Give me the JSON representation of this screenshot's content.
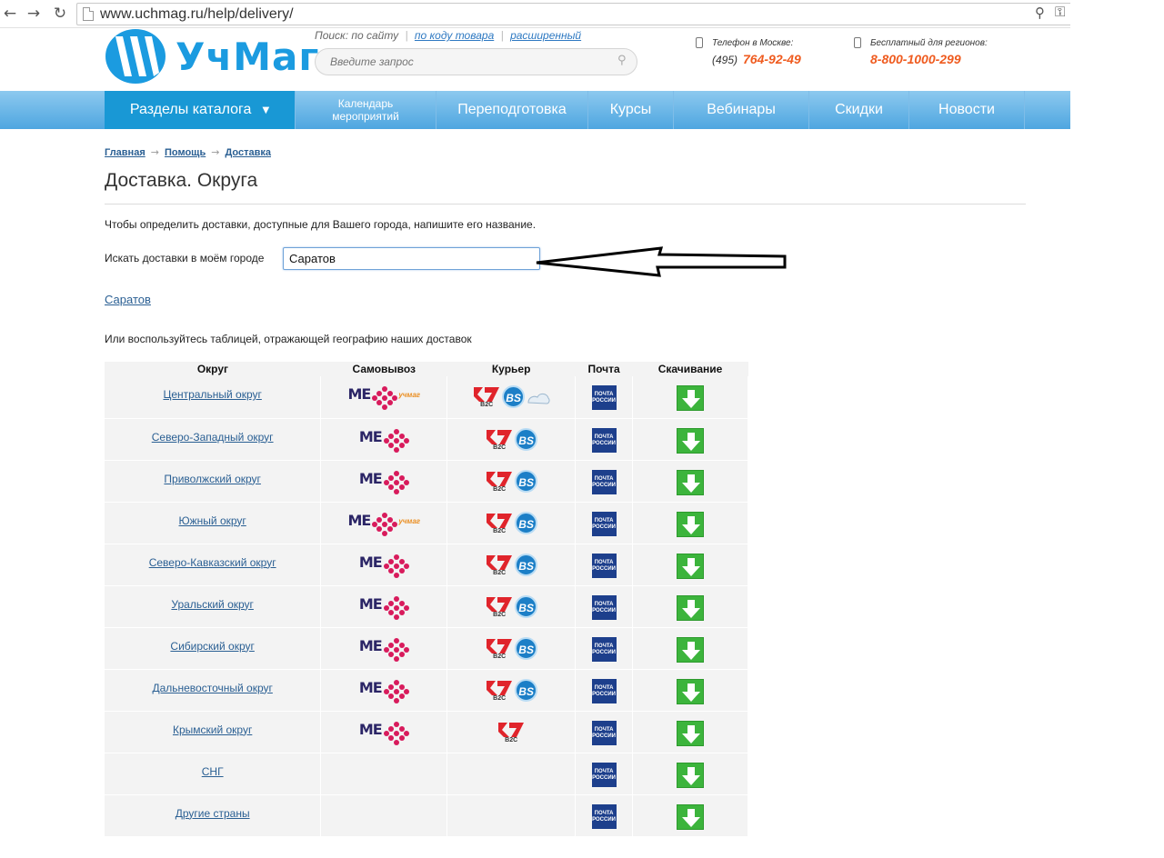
{
  "browser": {
    "back_icon": "←",
    "forward_icon": "→",
    "reload_icon": "↻",
    "url": "www.uchmag.ru/help/delivery/",
    "zoom_icon": "⚲",
    "key_icon": "⚿"
  },
  "header": {
    "logo_text": "УчМаг",
    "search_label": "Поиск:",
    "search_link_site": "по сайту",
    "search_link_code": "по коду товара",
    "search_link_ext": "расширенный",
    "search_placeholder": "Введите запрос",
    "moscow_label": "Телефон в Москве:",
    "moscow_code": "(495)",
    "moscow_phone": "764-92-49",
    "regions_label": "Бесплатный для регионов:",
    "regions_phone": "8-800-1000-299"
  },
  "nav": {
    "catalog": "Разделы каталога",
    "caret": "▼",
    "calendar_line1": "Календарь",
    "calendar_line2": "мероприятий",
    "retraining": "Переподготовка",
    "courses": "Курсы",
    "webinars": "Вебинары",
    "discounts": "Скидки",
    "news": "Новости"
  },
  "breadcrumb": {
    "home": "Главная",
    "help": "Помощь",
    "delivery": "Доставка",
    "arrow": "→"
  },
  "content": {
    "title": "Доставка. Округа",
    "intro": "Чтобы определить доставки, доступные для Вашего города, напишите его название.",
    "city_label": "Искать доставки в моём городе",
    "city_value": "Саратов",
    "city_link": "Саратов",
    "table_intro": "Или воспользуйтесь таблицей, отражающей географию наших доставок"
  },
  "table": {
    "headers": [
      "Округ",
      "Самовывоз",
      "Курьер",
      "Почта",
      "Скачивание"
    ],
    "pochta_label_1": "ПОЧТА",
    "pochta_label_2": "РОССИИ",
    "me_label": "ME",
    "uchmag_small": "учмаг",
    "b2c_label": "B2C",
    "bs_label": "BS",
    "rows": [
      {
        "name": "Центральный округ",
        "pickup": "me+uchmag",
        "courier": "b2c+bs+cloud",
        "post": true,
        "download": true
      },
      {
        "name": "Северо-Западный округ",
        "pickup": "me",
        "courier": "b2c+bs",
        "post": true,
        "download": true
      },
      {
        "name": "Приволжский округ",
        "pickup": "me",
        "courier": "b2c+bs",
        "post": true,
        "download": true
      },
      {
        "name": "Южный округ",
        "pickup": "me+uchmag",
        "courier": "b2c+bs",
        "post": true,
        "download": true
      },
      {
        "name": "Северо-Кавказский округ",
        "pickup": "me",
        "courier": "b2c+bs",
        "post": true,
        "download": true
      },
      {
        "name": "Уральский округ",
        "pickup": "me",
        "courier": "b2c+bs",
        "post": true,
        "download": true
      },
      {
        "name": "Сибирский округ",
        "pickup": "me",
        "courier": "b2c+bs",
        "post": true,
        "download": true
      },
      {
        "name": "Дальневосточный округ",
        "pickup": "me",
        "courier": "b2c+bs",
        "post": true,
        "download": true
      },
      {
        "name": "Крымский округ",
        "pickup": "me",
        "courier": "b2c",
        "post": true,
        "download": true
      },
      {
        "name": "СНГ",
        "pickup": "",
        "courier": "",
        "post": true,
        "download": true
      },
      {
        "name": "Другие страны",
        "pickup": "",
        "courier": "",
        "post": true,
        "download": true
      }
    ]
  },
  "colors": {
    "brand_blue": "#1b9be0",
    "phone_orange": "#ef5b1f",
    "nav_active": "#1998d5",
    "link": "#2a5f93",
    "download_green": "#3cb43c",
    "pochta_blue": "#1d3f8c",
    "b2c_red": "#e0242b",
    "me_berry": "#d81b5c"
  }
}
